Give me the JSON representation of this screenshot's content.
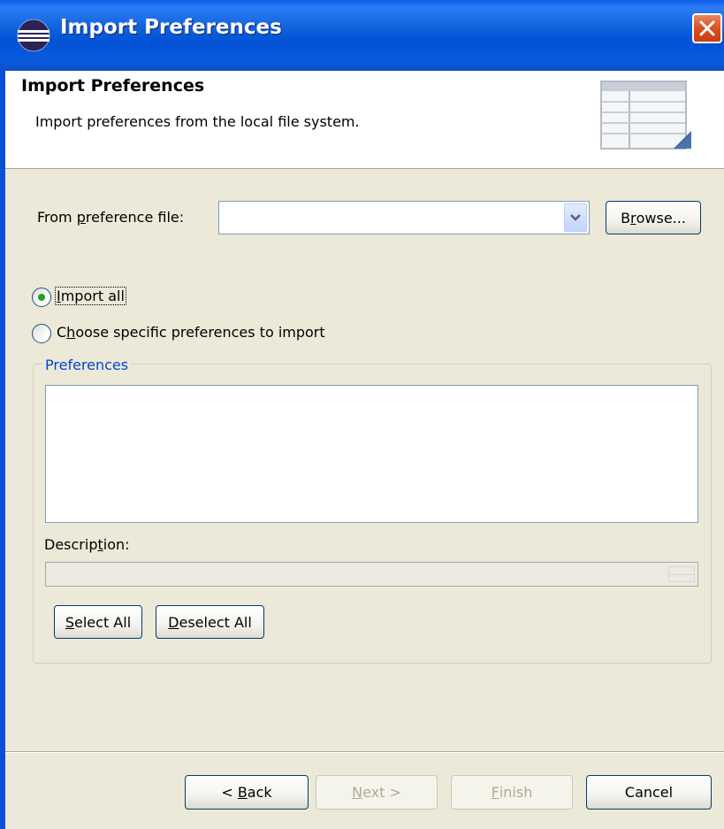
{
  "window": {
    "title": "Import Preferences"
  },
  "header": {
    "title": "Import Preferences",
    "description": "Import preferences from the local file system."
  },
  "file_row": {
    "label_pre": "From ",
    "label_mnemonic": "p",
    "label_post": "reference file:",
    "value": "",
    "browse_pre": "B",
    "browse_mnemonic": "r",
    "browse_post": "owse..."
  },
  "options": {
    "import_all_mnemonic": "I",
    "import_all_rest": "mport all",
    "import_all_selected": true,
    "choose_pre": "C",
    "choose_mnemonic": "h",
    "choose_post": "oose specific preferences to import",
    "choose_selected": false
  },
  "preferences_group": {
    "title": "Preferences",
    "items": [],
    "description_label_pre": "Descrip",
    "description_label_mnemonic": "t",
    "description_label_post": "ion:",
    "description_value": "",
    "select_all_mnemonic": "S",
    "select_all_rest": "elect All",
    "deselect_all_mnemonic": "D",
    "deselect_all_rest": "eselect All"
  },
  "footer": {
    "back_pre": "< ",
    "back_mnemonic": "B",
    "back_post": "ack",
    "next_mnemonic": "N",
    "next_post": "ext >",
    "finish_mnemonic": "F",
    "finish_post": "inish",
    "cancel_label": "Cancel"
  },
  "colors": {
    "titlebar": "#0a5bdc",
    "group_title": "#0046d5",
    "radio_selected": "#21a121",
    "close_button": "#dc4f1f"
  },
  "icons": [
    "eclipse-app-icon",
    "close-icon",
    "preferences-table-icon",
    "chevron-down-icon"
  ]
}
